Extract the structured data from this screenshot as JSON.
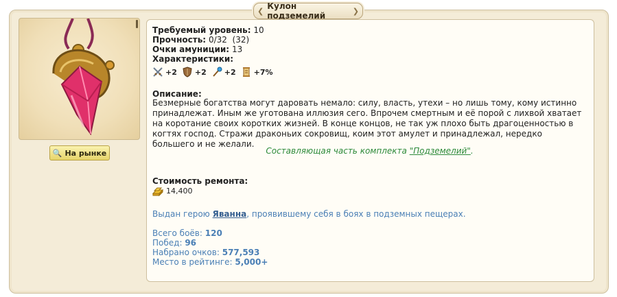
{
  "title": "Кулон подземелий",
  "market_button": "На рынке",
  "requirements": {
    "level_label": "Требуемый уровень:",
    "level_value": "10",
    "durability_label": "Прочность:",
    "durability_value": "0/32  (32)",
    "ammo_label": "Очки амуниции:",
    "ammo_value": "13",
    "stats_label": "Характеристики:"
  },
  "stats": [
    {
      "icon": "swords-icon",
      "value": "+2"
    },
    {
      "icon": "shield-icon",
      "value": "+2"
    },
    {
      "icon": "wand-icon",
      "value": "+2"
    },
    {
      "icon": "scroll-icon",
      "value": "+7%"
    }
  ],
  "description": {
    "label": "Описание:",
    "text": "Безмерные богатства могут даровать немало: силу, власть, утехи – но лишь тому, кому истинно принадлежат. Иным же уготована иллюзия сего. Впрочем смертным и её порой с лихвой хватает на коротание своих коротких жизней. В конце концов, не так уж плохо быть драгоценностью в когтях господ. Стражи драконьих сокровищ, коим этот амулет и принадлежал, нередко большего и не желали."
  },
  "set": {
    "prefix": "Составляющая часть комплекта ",
    "link": "\"Подземелий\"",
    "suffix": "."
  },
  "repair": {
    "label": "Стоимость ремонта:",
    "value": "14,400"
  },
  "issued": {
    "prefix": "Выдан герою ",
    "hero": "Яванна",
    "suffix": ", проявившему себя в боях в подземных пещерах."
  },
  "records": {
    "battles_label": "Всего боёв:",
    "battles_value": "120",
    "wins_label": "Побед:",
    "wins_value": "96",
    "points_label": "Набрано очков:",
    "points_value": "577,593",
    "rank_label": "Место в рейтинге:",
    "rank_value": "5,000+"
  },
  "colors": {
    "frame_bg": "#f4ecd8",
    "panel_bg": "#fffdf6",
    "set_green": "#2d8a3a",
    "info_blue": "#4a7fb5"
  }
}
